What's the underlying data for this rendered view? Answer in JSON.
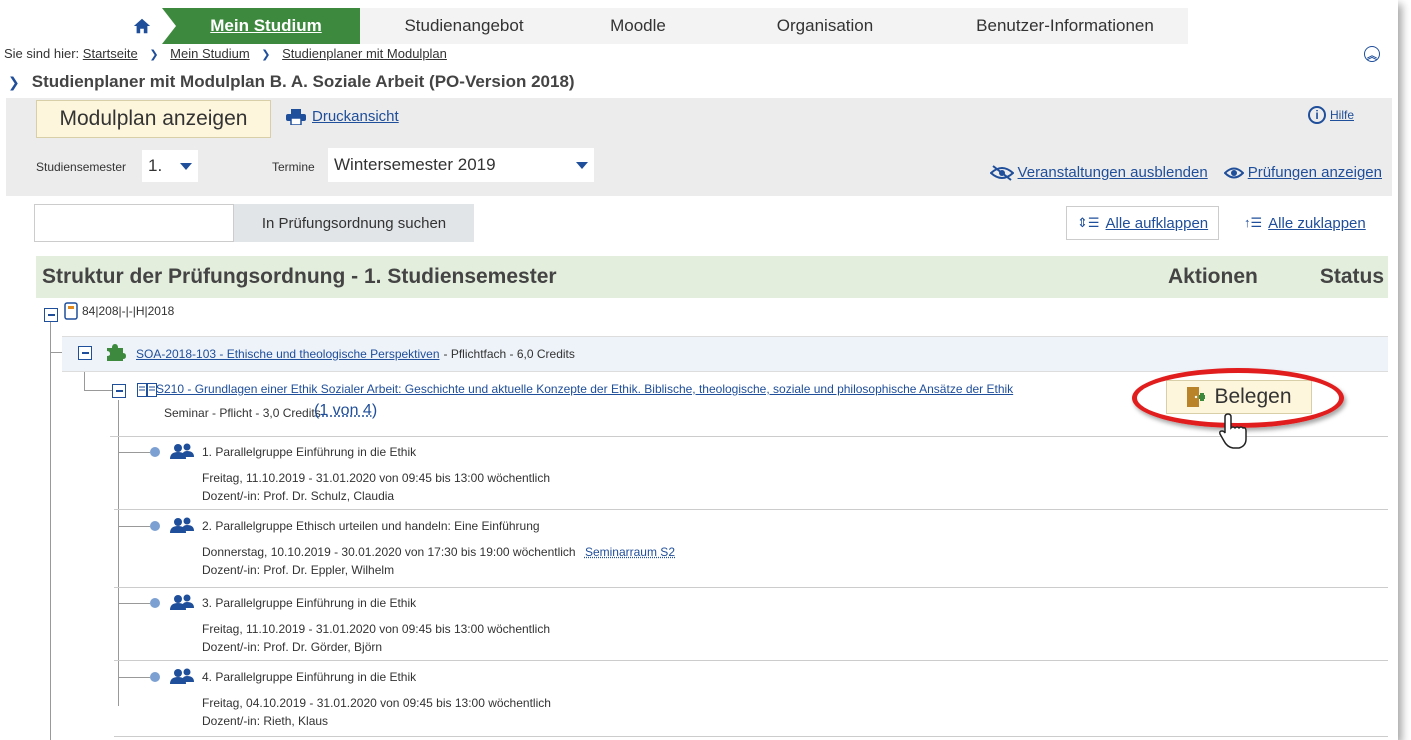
{
  "nav": {
    "home_icon": "home-icon",
    "active": "Mein Studium",
    "tabs": [
      "Studienangebot",
      "Moodle",
      "Organisation",
      "Benutzer-Informationen"
    ]
  },
  "breadcrumb": {
    "prefix": "Sie sind hier:",
    "items": [
      "Startseite",
      "Mein Studium",
      "Studienplaner mit Modulplan"
    ]
  },
  "page": {
    "title": "Studienplaner mit Modulplan B. A. Soziale Arbeit (PO-Version 2018)"
  },
  "panel": {
    "modulplan_btn": "Modulplan anzeigen",
    "druck": "Druckansicht",
    "hilfe": "Hilfe",
    "sem_label": "Studiensemester",
    "sem_value": "1.",
    "term_label": "Termine",
    "term_value": "Wintersemester 2019",
    "hide_events": "Veranstaltungen ausblenden",
    "show_exams": "Prüfungen anzeigen"
  },
  "search": {
    "input_value": "",
    "button": "In Prüfungsordnung suchen",
    "expand_all": "Alle aufklappen",
    "collapse_all": "Alle zuklappen"
  },
  "structure": {
    "title": "Struktur der Prüfungsordnung - 1. Studiensemester",
    "actions": "Aktionen",
    "status": "Status",
    "root": "84|208|-|-|H|2018",
    "module_link": "SOA-2018-103 - Ethische und theologische Perspektiven",
    "module_meta": "- Pflichtfach - 6,0 Credits",
    "seminar_link": "S210 - Grundlagen einer Ethik Sozialer Arbeit: Geschichte und aktuelle Konzepte der Ethik. Biblische, theologische, soziale und philosophische Ansätze der Ethik",
    "seminar_meta": "Seminar - Pflicht - 3,0 Credits",
    "seminar_count": "(1 von 4)",
    "belegen": "Belegen"
  },
  "groups": [
    {
      "title": "1. Parallelgruppe Einführung in die Ethik",
      "schedule": "Freitag, 11.10.2019 - 31.01.2020 von 09:45 bis 13:00 wöchentlich",
      "room": "",
      "lecturer": "Dozent/-in: Prof. Dr. Schulz, Claudia"
    },
    {
      "title": "2. Parallelgruppe Ethisch urteilen und handeln: Eine Einführung",
      "schedule": "Donnerstag, 10.10.2019 - 30.01.2020 von 17:30 bis 19:00 wöchentlich",
      "room": "Seminarraum S2",
      "lecturer": "Dozent/-in: Prof. Dr. Eppler, Wilhelm"
    },
    {
      "title": "3. Parallelgruppe Einführung in die Ethik",
      "schedule": "Freitag, 11.10.2019 - 31.01.2020 von 09:45 bis 13:00 wöchentlich",
      "room": "",
      "lecturer": "Dozent/-in: Prof. Dr. Görder, Björn"
    },
    {
      "title": "4. Parallelgruppe Einführung in die Ethik",
      "schedule": "Freitag, 04.10.2019 - 31.01.2020 von 09:45 bis 13:00 wöchentlich",
      "room": "",
      "lecturer": "Dozent/-in: Rieth, Klaus"
    }
  ],
  "colors": {
    "nav_active": "#3d8a3f",
    "link": "#1f4e9a",
    "highlight": "#e11d1d"
  }
}
